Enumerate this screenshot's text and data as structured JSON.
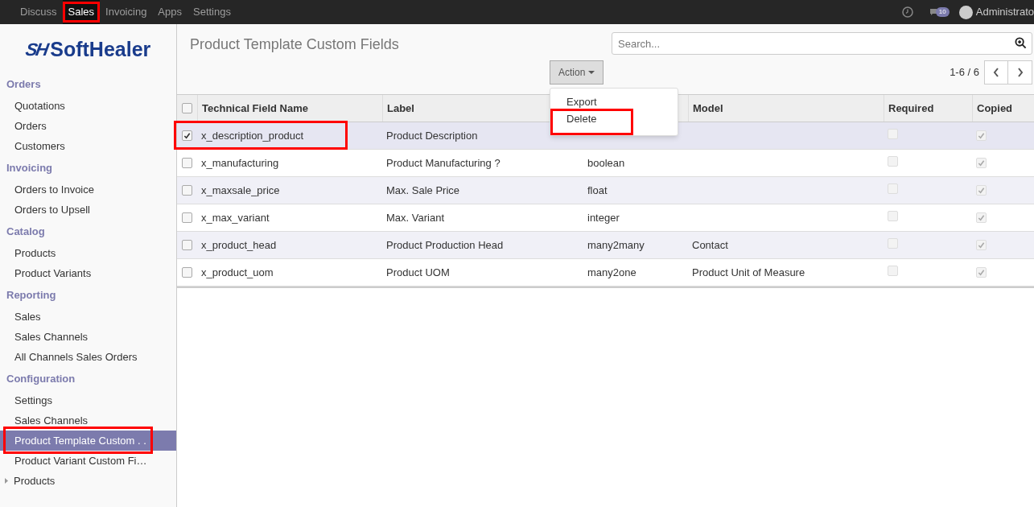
{
  "top_menu": [
    {
      "label": "Discuss",
      "selected": false,
      "highlighted": false
    },
    {
      "label": "Sales",
      "selected": true,
      "highlighted": true
    },
    {
      "label": "Invoicing",
      "selected": false,
      "highlighted": false
    },
    {
      "label": "Apps",
      "selected": false,
      "highlighted": false
    },
    {
      "label": "Settings",
      "selected": false,
      "highlighted": false
    }
  ],
  "systray": {
    "message_count": "10",
    "user": "Administrato"
  },
  "logo": {
    "mark": "SH",
    "name": "SoftHealer"
  },
  "sidebar": [
    {
      "heading": "Orders",
      "items": [
        {
          "label": "Quotations",
          "selected": false,
          "highlighted": false
        },
        {
          "label": "Orders",
          "selected": false,
          "highlighted": false
        },
        {
          "label": "Customers",
          "selected": false,
          "highlighted": false
        }
      ]
    },
    {
      "heading": "Invoicing",
      "items": [
        {
          "label": "Orders to Invoice",
          "selected": false,
          "highlighted": false
        },
        {
          "label": "Orders to Upsell",
          "selected": false,
          "highlighted": false
        }
      ]
    },
    {
      "heading": "Catalog",
      "items": [
        {
          "label": "Products",
          "selected": false,
          "highlighted": false
        },
        {
          "label": "Product Variants",
          "selected": false,
          "highlighted": false
        }
      ]
    },
    {
      "heading": "Reporting",
      "items": [
        {
          "label": "Sales",
          "selected": false,
          "highlighted": false
        },
        {
          "label": "Sales Channels",
          "selected": false,
          "highlighted": false
        },
        {
          "label": "All Channels Sales Orders",
          "selected": false,
          "highlighted": false
        }
      ]
    },
    {
      "heading": "Configuration",
      "items": [
        {
          "label": "Settings",
          "selected": false,
          "highlighted": false
        },
        {
          "label": "Sales Channels",
          "selected": false,
          "highlighted": false
        },
        {
          "label": "Product Template Custom . .",
          "selected": true,
          "highlighted": true
        },
        {
          "label": "Product Variant Custom Fi…",
          "selected": false,
          "highlighted": false
        }
      ]
    }
  ],
  "sidebar_tree": [
    {
      "label": "Products",
      "expanded": false
    }
  ],
  "page_title": "Product Template Custom Fields",
  "search": {
    "placeholder": "Search..."
  },
  "action_button": "Action",
  "action_menu": [
    {
      "label": "Export",
      "highlighted": false
    },
    {
      "label": "Delete",
      "highlighted": true
    }
  ],
  "pager": "1-6 / 6",
  "table": {
    "select_all": false,
    "columns": [
      "Technical Field Name",
      "Label",
      "",
      "Model",
      "Required",
      "Copied"
    ],
    "rows": [
      {
        "selected": true,
        "highlighted": true,
        "name": "x_description_product",
        "label": "Product Description",
        "column_3": "",
        "model": "",
        "required": false,
        "copied": true
      },
      {
        "selected": false,
        "highlighted": false,
        "name": "x_manufacturing",
        "label": "Product Manufacturing ?",
        "column_3": "boolean",
        "model": "",
        "required": false,
        "copied": true
      },
      {
        "selected": false,
        "highlighted": false,
        "name": "x_maxsale_price",
        "label": "Max. Sale Price",
        "column_3": "float",
        "model": "",
        "required": false,
        "copied": true
      },
      {
        "selected": false,
        "highlighted": false,
        "name": "x_max_variant",
        "label": "Max. Variant",
        "column_3": "integer",
        "model": "",
        "required": false,
        "copied": true
      },
      {
        "selected": false,
        "highlighted": false,
        "name": "x_product_head",
        "label": "Product Production Head",
        "column_3": "many2many",
        "model": "Contact",
        "required": false,
        "copied": true
      },
      {
        "selected": false,
        "highlighted": false,
        "name": "x_product_uom",
        "label": "Product UOM",
        "column_3": "many2one",
        "model": "Product Unit of Measure",
        "required": false,
        "copied": true
      }
    ]
  }
}
